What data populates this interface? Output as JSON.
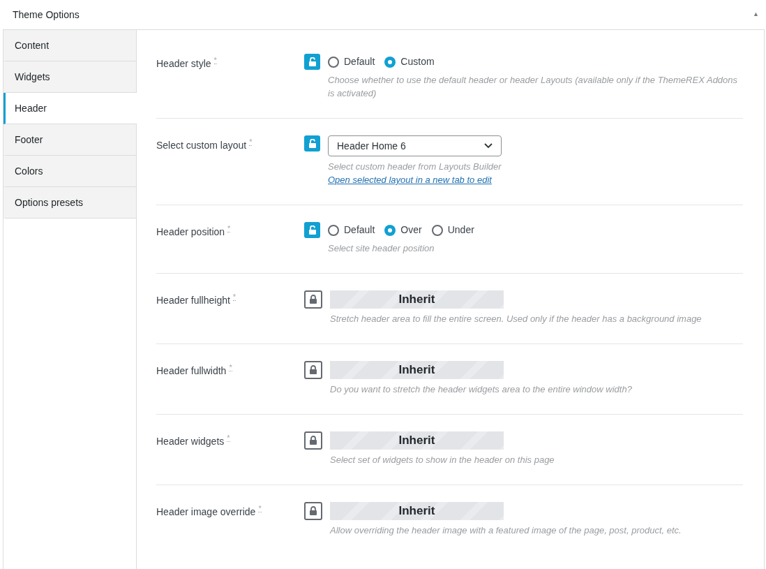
{
  "panel": {
    "title": "Theme Options",
    "collapse_glyph": "▲"
  },
  "tabs": [
    {
      "label": "Content",
      "selected": false
    },
    {
      "label": "Widgets",
      "selected": false
    },
    {
      "label": "Header",
      "selected": true
    },
    {
      "label": "Footer",
      "selected": false
    },
    {
      "label": "Colors",
      "selected": false
    },
    {
      "label": "Options presets",
      "selected": false
    }
  ],
  "fields": [
    {
      "label": "Header style",
      "mark": "*",
      "locked": false,
      "kind": "radio",
      "options": [
        {
          "label": "Default",
          "selected": false
        },
        {
          "label": "Custom",
          "selected": true
        }
      ],
      "description": "Choose whether to use the default header or header Layouts (available only if the ThemeREX Addons is activated)"
    },
    {
      "label": "Select custom layout",
      "mark": "*",
      "locked": false,
      "kind": "select",
      "value": "Header Home 6",
      "description": "Select custom header from Layouts Builder",
      "link": "Open selected layout in a new tab to edit"
    },
    {
      "label": "Header position",
      "mark": "*",
      "locked": false,
      "kind": "radio",
      "options": [
        {
          "label": "Default",
          "selected": false
        },
        {
          "label": "Over",
          "selected": true
        },
        {
          "label": "Under",
          "selected": false
        }
      ],
      "description": "Select site header position"
    },
    {
      "label": "Header fullheight",
      "mark": "*",
      "locked": true,
      "kind": "inherit",
      "value": "Inherit",
      "description": "Stretch header area to fill the entire screen. Used only if the header has a background image"
    },
    {
      "label": "Header fullwidth",
      "mark": "*",
      "locked": true,
      "kind": "inherit",
      "value": "Inherit",
      "description": "Do you want to stretch the header widgets area to the entire window width?"
    },
    {
      "label": "Header widgets",
      "mark": "*",
      "locked": true,
      "kind": "inherit",
      "value": "Inherit",
      "description": "Select set of widgets to show in the header on this page"
    },
    {
      "label": "Header image override",
      "mark": "*",
      "locked": true,
      "kind": "inherit",
      "value": "Inherit",
      "description": "Allow overriding the header image with a featured image of the page, post, product, etc."
    }
  ]
}
